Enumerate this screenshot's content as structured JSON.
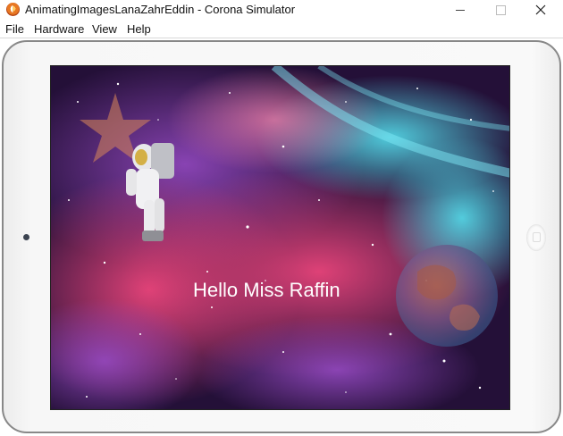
{
  "window": {
    "title": "AnimatingImagesLanaZahrEddin - Corona Simulator"
  },
  "menu": [
    "File",
    "Hardware",
    "View",
    "Help"
  ],
  "screen": {
    "text": "Hello Miss Raffin",
    "text_color": "#ffffff"
  },
  "colors": {
    "space_dark": "#2a0d3a",
    "nebula_pink": "#d2326e",
    "nebula_cyan": "#4fd7e8",
    "device_frame": "#f5f5f5"
  },
  "icons": {
    "app": "corona-icon",
    "minimize": "minimize-icon",
    "maximize": "maximize-icon",
    "close": "close-icon",
    "star": "star-icon",
    "astronaut": "astronaut-image",
    "earth": "earth-image"
  }
}
